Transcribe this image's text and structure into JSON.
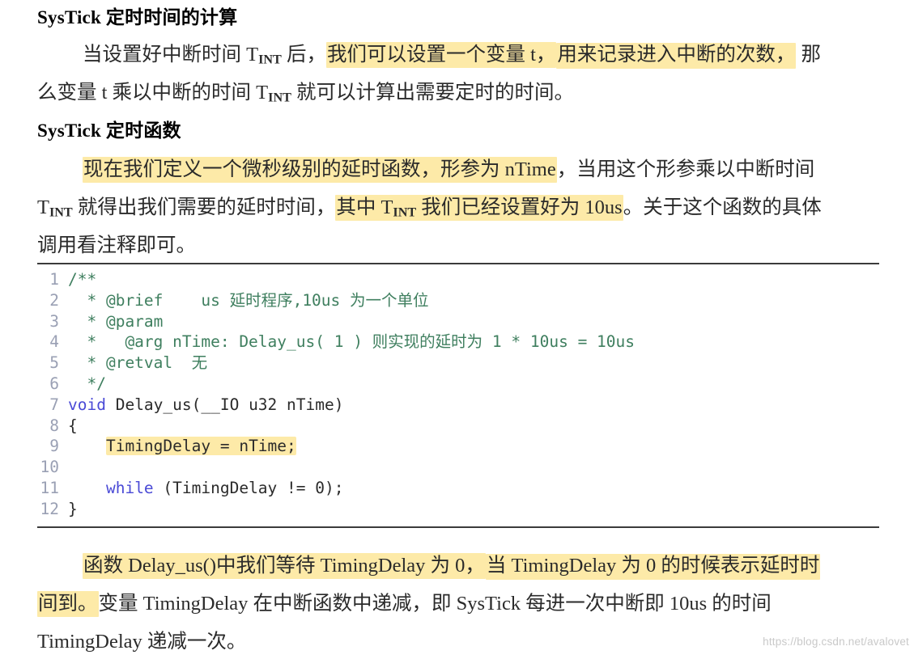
{
  "document": {
    "headings": {
      "calc": {
        "bold_prefix": "SysTick",
        "rest": " 定时时间的计算"
      },
      "func": {
        "bold_prefix": "SysTick",
        "rest": " 定时函数"
      }
    },
    "paragraph1": {
      "line1_a": "当设置好中断时间 T",
      "line1_sub": "INT",
      "line1_b": " 后，",
      "line1_hl": "我们可以设置一个变量 t，",
      "line1_hl2": "用来记录进入中断的次数，",
      "line1_c": " 那",
      "line2_a": "么变量 t 乘以中断的时间 T",
      "line2_sub": "INT",
      "line2_b": " 就可以计算出需要定时的时间。"
    },
    "paragraph2": {
      "line1_hl_a": "现在我们定义一个微秒级别的延时函数，形参为 nTime",
      "line1_b": "，当用这个形参乘以中断时间",
      "line2_a": "T",
      "line2_sub": "INT",
      "line2_b": " 就得出我们需要的延时时间，",
      "line2_hl_a": "其中 T",
      "line2_hl_sub": "INT",
      "line2_hl_b": " 我们已经设置好为 10us",
      "line2_c": "。关于这个函数的具体",
      "line3": "调用看注释即可。"
    },
    "paragraph3": {
      "line1_hl_a": "函数 Delay_us()中我们等待 TimingDelay 为 0，",
      "line1_hl_b": "当 TimingDelay 为 0 的时候表示延时时",
      "line2_hl": "间到。",
      "line2_rest": "变量 TimingDelay 在中断函数中递减，即 SysTick 每进一次中断即 10us 的时间",
      "line3": "TimingDelay 递减一次。"
    },
    "code": {
      "language": "c",
      "lines": [
        {
          "number": "1",
          "segments": [
            {
              "text": "/**",
              "style": "comment"
            }
          ]
        },
        {
          "number": "2",
          "segments": [
            {
              "text": "  * @brief    us 延时程序,10us 为一个单位",
              "style": "comment"
            }
          ]
        },
        {
          "number": "3",
          "segments": [
            {
              "text": "  * @param",
              "style": "comment"
            }
          ]
        },
        {
          "number": "4",
          "segments": [
            {
              "text": "  *   @arg nTime: Delay_us( 1 ) 则实现的延时为 1 * 10us = 10us",
              "style": "comment"
            }
          ]
        },
        {
          "number": "5",
          "segments": [
            {
              "text": "  * @retval  无",
              "style": "comment"
            }
          ]
        },
        {
          "number": "6",
          "segments": [
            {
              "text": "  */",
              "style": "comment"
            }
          ]
        },
        {
          "number": "7",
          "segments": [
            {
              "text": "void",
              "style": "keyword"
            },
            {
              "text": " Delay_us(__IO u32 nTime)",
              "style": "plain"
            }
          ]
        },
        {
          "number": "8",
          "segments": [
            {
              "text": "{",
              "style": "plain"
            }
          ]
        },
        {
          "number": "9",
          "segments": [
            {
              "text": "    ",
              "style": "plain"
            },
            {
              "text": "TimingDelay = nTime;",
              "style": "plain-highlight"
            }
          ]
        },
        {
          "number": "10",
          "segments": [
            {
              "text": "",
              "style": "plain"
            }
          ]
        },
        {
          "number": "11",
          "segments": [
            {
              "text": "    ",
              "style": "plain"
            },
            {
              "text": "while",
              "style": "keyword"
            },
            {
              "text": " (TimingDelay != 0);",
              "style": "plain"
            }
          ]
        },
        {
          "number": "12",
          "segments": [
            {
              "text": "}",
              "style": "plain"
            }
          ]
        }
      ]
    },
    "watermark": "https://blog.csdn.net/avalovet",
    "colors": {
      "highlight": "#fdeaa8",
      "comment": "#3f7f5f",
      "keyword": "#4a4ad6",
      "gutter": "#9aa0b4",
      "text": "#2a2a2a",
      "rule": "#3b3b3b",
      "watermark": "#c9c9c9"
    }
  }
}
